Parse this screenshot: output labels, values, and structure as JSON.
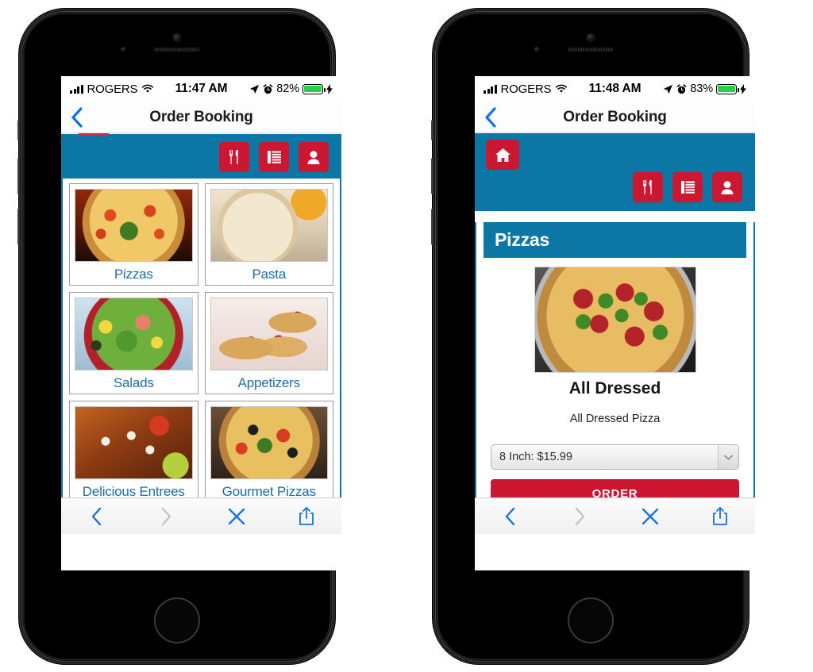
{
  "phones": [
    {
      "id": "left",
      "status_bar": {
        "carrier": "ROGERS",
        "time": "11:47 AM",
        "battery_percent": "82%",
        "signal_icon": "signal-bars-icon",
        "wifi_icon": "wifi-icon",
        "location_icon": "location-arrow-icon",
        "alarm_icon": "alarm-clock-icon",
        "battery_icon": "battery-icon",
        "charging_icon": "lightning-bolt-icon"
      },
      "navbar": {
        "title": "Order Booking",
        "back_icon": "chevron-left-icon"
      },
      "appbar": {
        "has_home_button": false,
        "buttons": [
          {
            "name": "restaurant-button",
            "icon": "fork-knife-icon"
          },
          {
            "name": "orders-button",
            "icon": "list-icon"
          },
          {
            "name": "account-button",
            "icon": "person-icon"
          }
        ]
      },
      "categories": [
        {
          "label": "Pizzas",
          "image": "img-pizzas"
        },
        {
          "label": "Pasta",
          "image": "img-pasta"
        },
        {
          "label": "Salads",
          "image": "img-salads"
        },
        {
          "label": "Appetizers",
          "image": "img-appetizers"
        },
        {
          "label": "Delicious Entrees",
          "image": "img-entrees"
        },
        {
          "label": "Gourmet Pizzas",
          "image": "img-gourmet"
        }
      ]
    },
    {
      "id": "right",
      "status_bar": {
        "carrier": "ROGERS",
        "time": "11:48 AM",
        "battery_percent": "83%",
        "signal_icon": "signal-bars-icon",
        "wifi_icon": "wifi-icon",
        "location_icon": "location-arrow-icon",
        "alarm_icon": "alarm-clock-icon",
        "battery_icon": "battery-icon",
        "charging_icon": "lightning-bolt-icon"
      },
      "navbar": {
        "title": "Order Booking",
        "back_icon": "chevron-left-icon"
      },
      "appbar": {
        "has_home_button": true,
        "home_icon": "house-icon",
        "buttons": [
          {
            "name": "restaurant-button",
            "icon": "fork-knife-icon"
          },
          {
            "name": "orders-button",
            "icon": "list-icon"
          },
          {
            "name": "account-button",
            "icon": "person-icon"
          }
        ]
      },
      "product": {
        "section_title": "Pizzas",
        "image": "img-alldressed",
        "name": "All Dressed",
        "description": "All Dressed Pizza",
        "size_select_value": "8 Inch: $15.99",
        "size_select_arrow_icon": "chevron-down-icon",
        "order_button_label": "ORDER"
      }
    }
  ],
  "browser_toolbar": {
    "items": [
      {
        "name": "back-button",
        "icon": "chevron-left-icon",
        "state": "enabled"
      },
      {
        "name": "forward-button",
        "icon": "chevron-right-icon",
        "state": "disabled"
      },
      {
        "name": "close-button",
        "icon": "close-x-icon",
        "state": "enabled"
      },
      {
        "name": "share-button",
        "icon": "share-icon",
        "state": "enabled"
      }
    ]
  },
  "colors": {
    "brand_blue": "#0c77a4",
    "brand_red": "#cc1733",
    "link_blue": "#1a6fa8",
    "ios_blue": "#0a7cff",
    "battery_green": "#25d145"
  }
}
